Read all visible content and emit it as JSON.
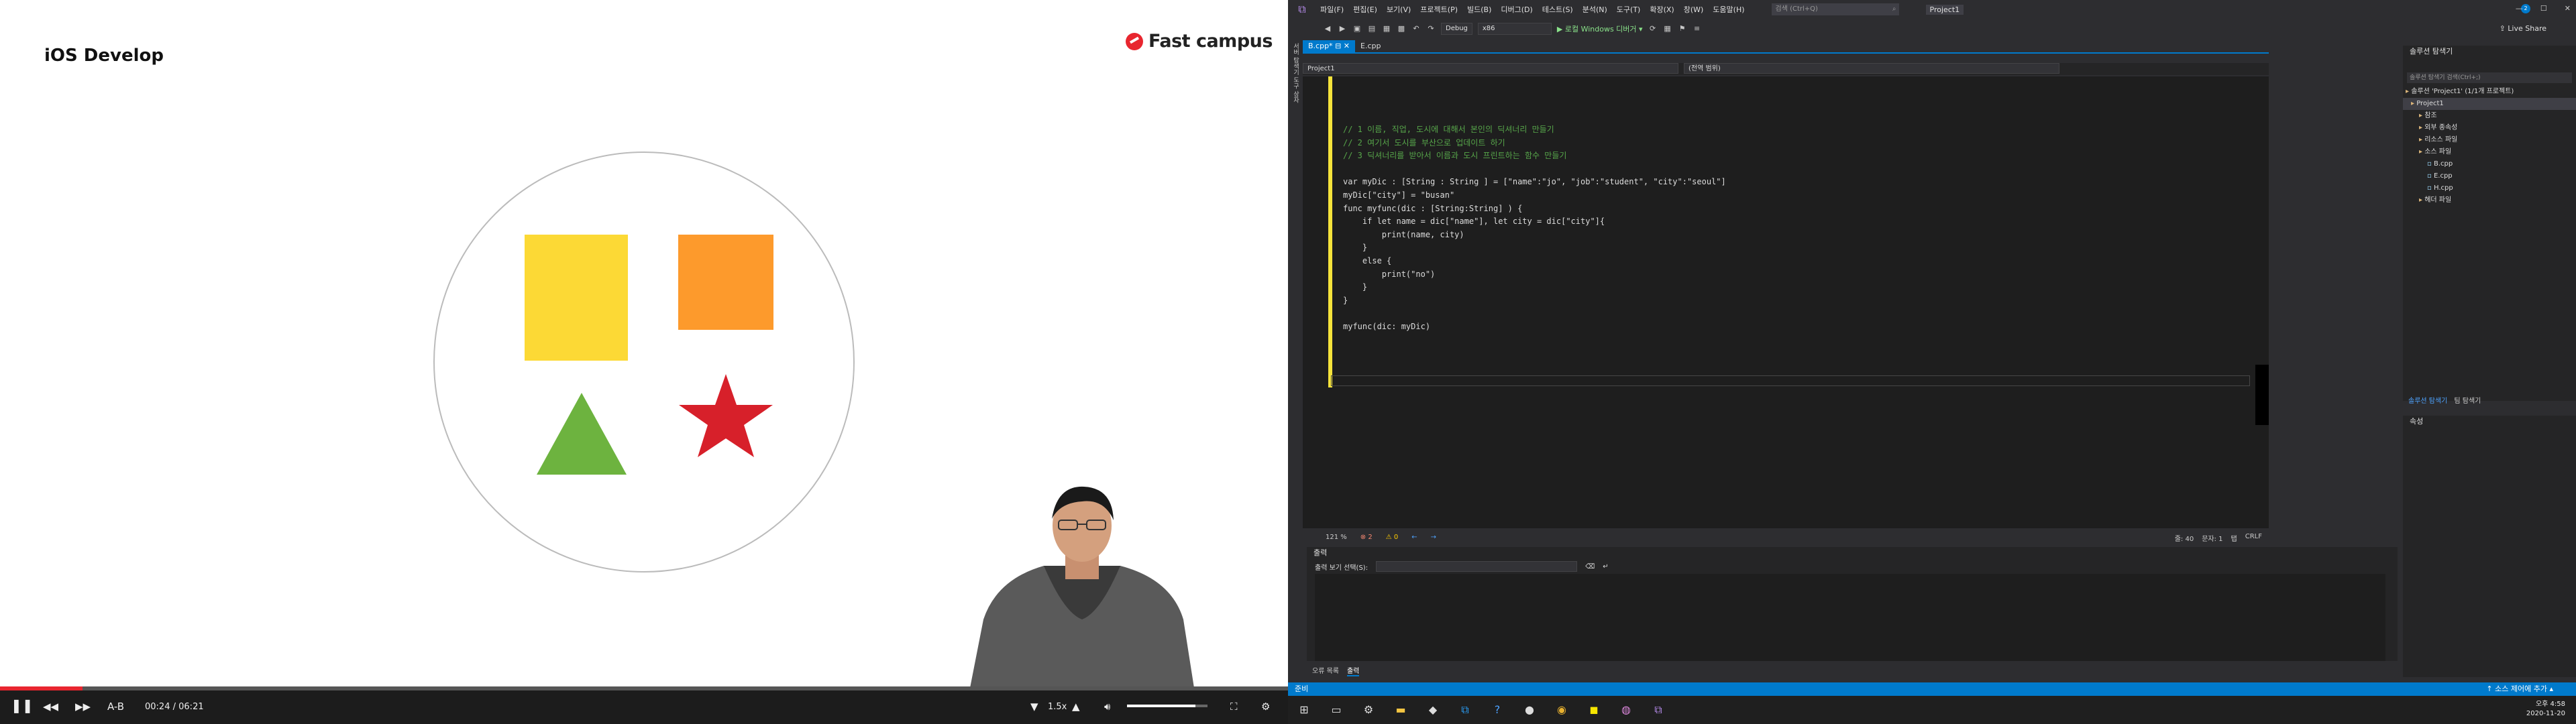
{
  "left": {
    "slide": {
      "title": "iOS Develop",
      "brand": "Fast campus"
    },
    "player": {
      "loop": "A-B",
      "time_current": "00:24",
      "time_separator": "/",
      "time_total": "06:21",
      "speed": "1.5x",
      "progress": 0.064,
      "volume": 0.85
    }
  },
  "vs": {
    "menu": [
      "파일(F)",
      "편집(E)",
      "보기(V)",
      "프로젝트(P)",
      "빌드(B)",
      "디버그(D)",
      "테스트(S)",
      "분석(N)",
      "도구(T)",
      "확장(X)",
      "창(W)",
      "도움말(H)"
    ],
    "search_placeholder": "검색 (Ctrl+Q)",
    "project_name": "Project1",
    "notification_count": "2",
    "toolbar": {
      "config": "Debug",
      "platform": "x86",
      "run": "▶ 로컬 Windows 디버거 ▾",
      "liveshare": "Live Share"
    },
    "doc_tabs": [
      "B.cpp*",
      "E.cpp"
    ],
    "nav": {
      "project": "Project1",
      "scope": "(전역 범위)"
    },
    "code_lines": [
      "// 1 이름, 직업, 도시에 대해서 본인의 딕셔너리 만들기",
      "// 2 여기서 도시를 부산으로 업데이트 하기",
      "// 3 딕셔너리를 받아서 이름과 도시 프린트하는 함수 만들기",
      "",
      "var myDic : [String : String ] = [\"name\":\"jo\", \"job\":\"student\", \"city\":\"seoul\"]",
      "myDic[\"city\"] = \"busan\"",
      "func myfunc(dic : [String:String] ) {",
      "    if let name = dic[\"name\"], let city = dic[\"city\"]{",
      "        print(name, city)",
      "    }",
      "    else {",
      "        print(\"no\")",
      "    }",
      "}",
      "",
      "myfunc(dic: myDic)"
    ],
    "editor_status": {
      "zoom": "121 %",
      "errors": "2",
      "warnings": "0",
      "line": "줄: 40",
      "col": "문자: 1",
      "tab": "탭",
      "eol": "CRLF"
    },
    "solution": {
      "title": "솔루션 탐색기",
      "search": "솔루션 탐색기 검색(Ctrl+;)",
      "items": [
        "솔루션 'Project1' (1/1개 프로젝트)",
        "Project1",
        "참조",
        "외부 종속성",
        "리소스 파일",
        "소스 파일",
        "B.cpp",
        "E.cpp",
        "H.cpp",
        "헤더 파일"
      ],
      "tabs": [
        "솔루션 탐색기",
        "팀 탐색기"
      ]
    },
    "properties": {
      "title": "속성"
    },
    "output": {
      "title": "출력",
      "source_label": "출력 보기 선택(S):"
    },
    "bottom_tabs": [
      "오류 목록",
      "출력"
    ],
    "status": {
      "left": "준비",
      "right": "↑ 소스 제어에 추가 ▴"
    },
    "clock": {
      "time": "오후 4:58",
      "date": "2020-11-20"
    }
  }
}
